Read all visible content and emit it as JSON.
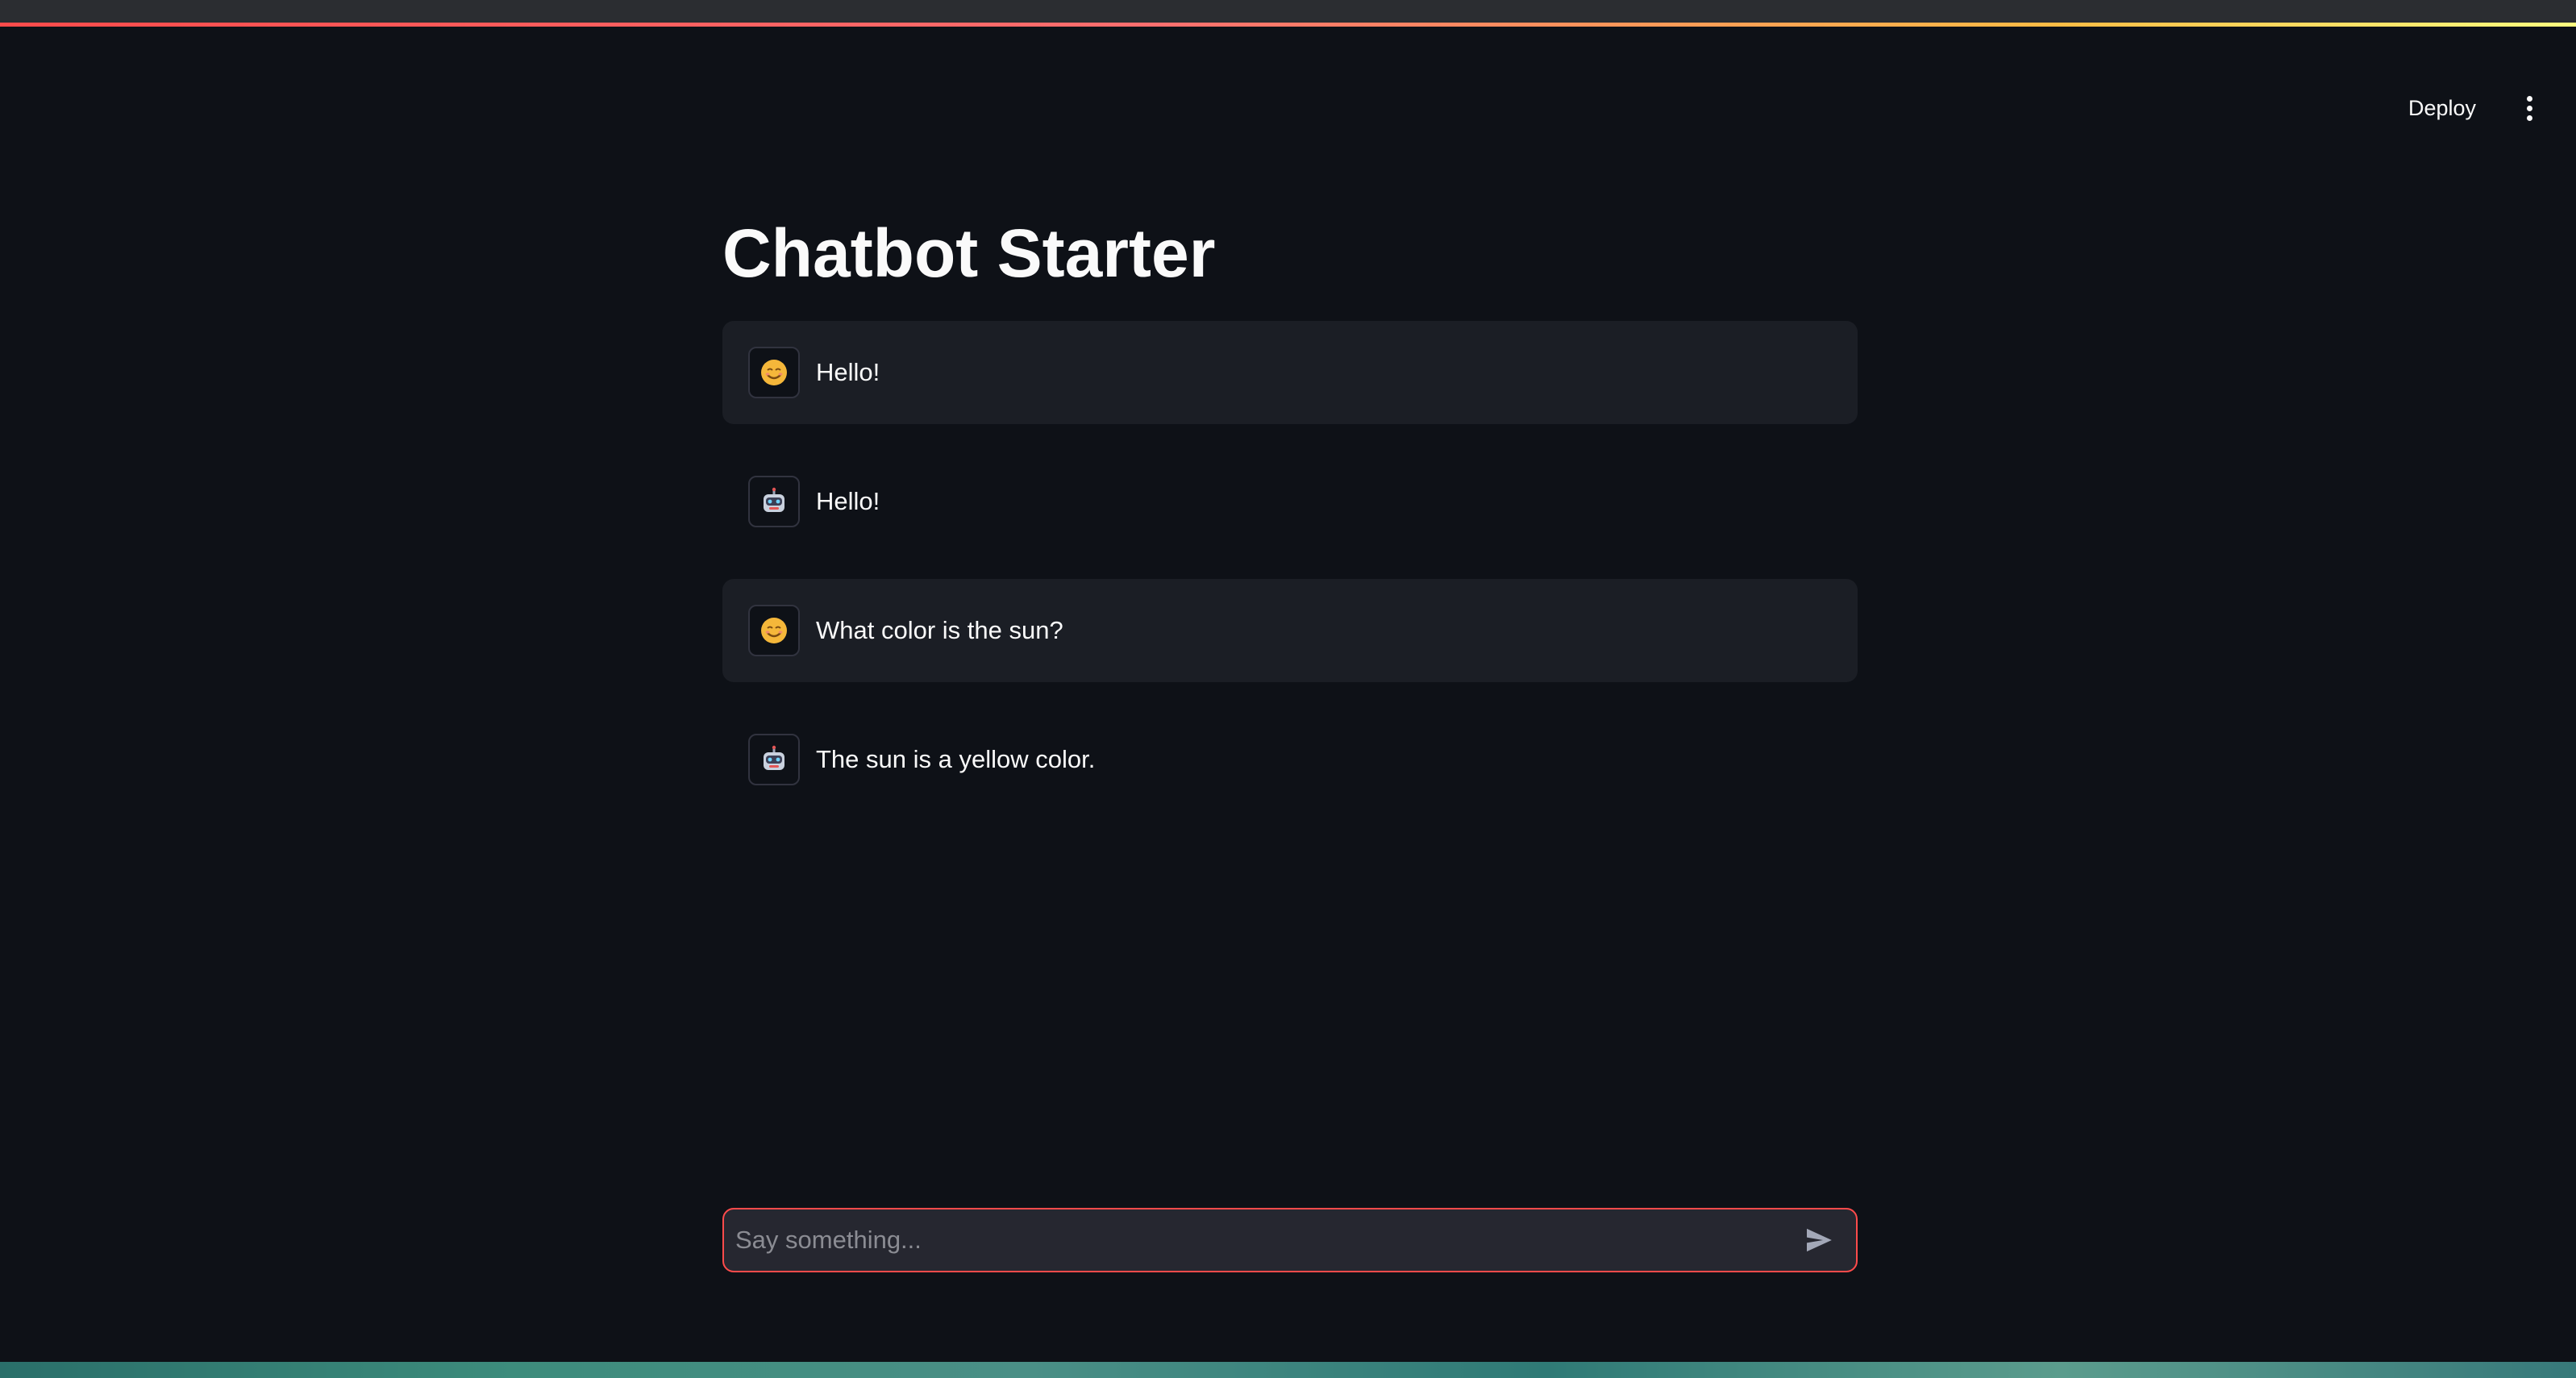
{
  "app": {
    "title": "Chatbot Starter",
    "deploy_label": "Deploy",
    "menu_icon": "kebab-menu-icon"
  },
  "messages": [
    {
      "role": "user",
      "avatar_icon": "smiley-face-icon",
      "text": "Hello!"
    },
    {
      "role": "assistant",
      "avatar_icon": "robot-face-icon",
      "text": "Hello!"
    },
    {
      "role": "user",
      "avatar_icon": "smiley-face-icon",
      "text": "What color is the sun?"
    },
    {
      "role": "assistant",
      "avatar_icon": "robot-face-icon",
      "text": "The sun is a yellow color."
    }
  ],
  "chat_input": {
    "placeholder": "Say something...",
    "value": "",
    "send_icon": "send-arrow-icon"
  },
  "colors": {
    "background": "#0e1117",
    "user_message_bg": "#1b1e25",
    "input_border_accent": "#ff4b4b",
    "input_bg": "#262730",
    "text": "#fafafa"
  }
}
